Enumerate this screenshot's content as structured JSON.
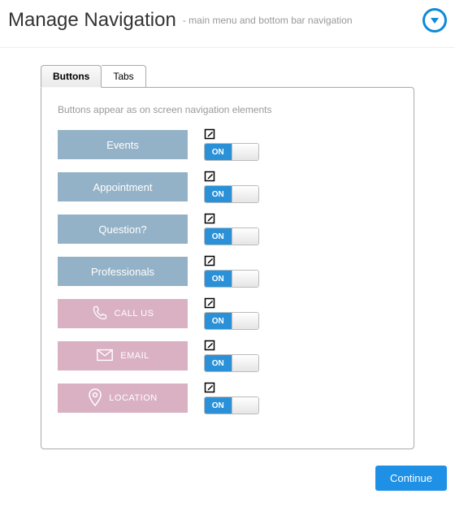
{
  "header": {
    "title": "Manage Navigation",
    "subtitle": "- main menu and bottom bar navigation"
  },
  "tabs": {
    "active": "Buttons",
    "inactive": "Tabs"
  },
  "panel": {
    "note": "Buttons appear as on screen navigation elements",
    "toggle_label": "ON",
    "items": [
      {
        "label": "Events",
        "style": "blue",
        "icon": null,
        "state": "ON"
      },
      {
        "label": "Appointment",
        "style": "blue",
        "icon": null,
        "state": "ON"
      },
      {
        "label": "Question?",
        "style": "blue",
        "icon": null,
        "state": "ON"
      },
      {
        "label": "Professionals",
        "style": "blue",
        "icon": null,
        "state": "ON"
      },
      {
        "label": "CALL US",
        "style": "pink",
        "icon": "phone",
        "state": "ON"
      },
      {
        "label": "EMAIL",
        "style": "pink",
        "icon": "envelope",
        "state": "ON"
      },
      {
        "label": "LOCATION",
        "style": "pink",
        "icon": "pin",
        "state": "ON"
      }
    ]
  },
  "footer": {
    "continue": "Continue"
  }
}
